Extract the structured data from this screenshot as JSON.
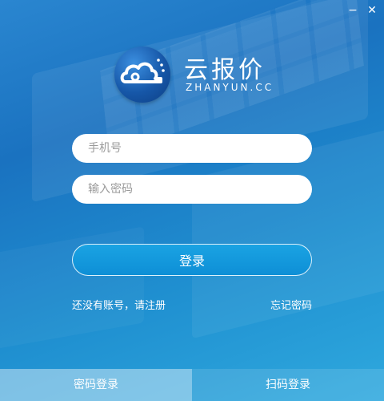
{
  "window": {
    "minimize_glyph": "−",
    "close_glyph": "✕"
  },
  "brand": {
    "name": "云报价",
    "domain": "ZHANYUN.CC",
    "logo_icon": "cloud-logo-icon"
  },
  "form": {
    "phone_placeholder": "手机号",
    "phone_value": "",
    "password_placeholder": "输入密码",
    "password_value": "",
    "login_label": "登录"
  },
  "links": {
    "register": "还没有账号，请注册",
    "forgot": "忘记密码"
  },
  "tabs": [
    {
      "label": "密码登录",
      "active": true
    },
    {
      "label": "扫码登录",
      "active": false
    }
  ],
  "colors": {
    "accent": "#1a9de0",
    "background": "#1f8fd0"
  }
}
